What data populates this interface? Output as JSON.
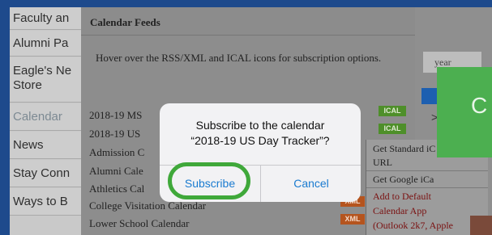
{
  "sidebar": {
    "items": [
      {
        "label": "Faculty an"
      },
      {
        "label": "Alumni Pa"
      },
      {
        "label": "Eagle's Ne"
      },
      {
        "label": "Store"
      },
      {
        "label": "Calendar"
      },
      {
        "label": "News"
      },
      {
        "label": "Stay Conn"
      },
      {
        "label": "Ways to B"
      }
    ]
  },
  "right": {
    "year_label": "year",
    "arrow": ">",
    "green_panel_letter": "C"
  },
  "feeds": {
    "title": "Calendar Feeds",
    "instructions": "Hover over the RSS/XML and ICAL icons for subscription options.",
    "rows": [
      {
        "label": "2018-19 MS"
      },
      {
        "label": "2018-19 US"
      },
      {
        "label": "Admission C"
      },
      {
        "label": "Alumni Cale"
      },
      {
        "label": "Athletics Cal"
      },
      {
        "label": "College Visitation Calendar"
      },
      {
        "label": "Lower School Calendar"
      }
    ],
    "xml_tag": "XML",
    "ical_tag": "ICAL"
  },
  "dropdown": {
    "items": [
      "Get Standard iC",
      "URL",
      "Get Google iCa",
      "Add to Default",
      "Calendar App",
      "(Outlook 2k7, Apple"
    ]
  },
  "alert": {
    "title_line1": "Subscribe to the calendar",
    "title_line2": "“2018-19 US Day Tracker”?",
    "subscribe_label": "Subscribe",
    "cancel_label": "Cancel"
  },
  "colors": {
    "page_frame": "#1e4a8c",
    "highlight_ring": "#3fa83a",
    "ios_blue": "#1a7bd0",
    "green_panel": "#4caf50"
  }
}
